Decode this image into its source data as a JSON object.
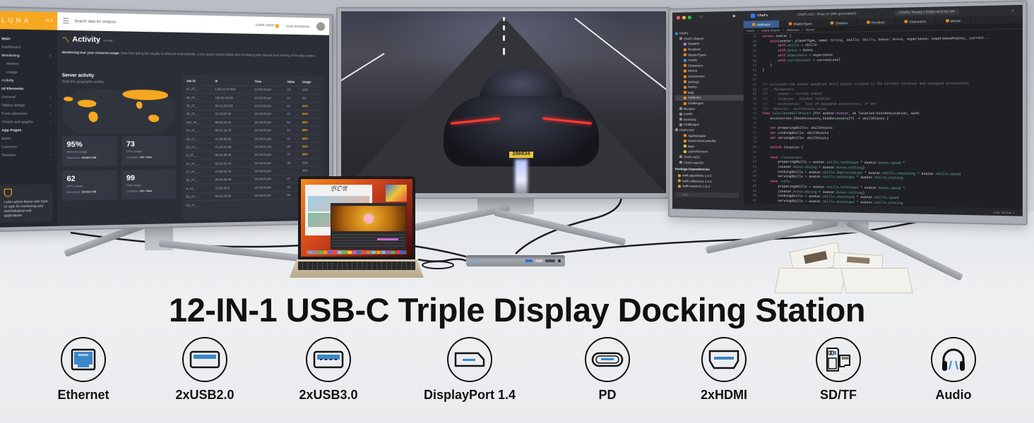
{
  "title": "12-IN-1 USB-C Triple Display Docking Station",
  "ports": [
    {
      "label": "Ethernet",
      "icon": "ethernet-port-icon"
    },
    {
      "label": "2xUSB2.0",
      "icon": "usb2-port-icon"
    },
    {
      "label": "2xUSB3.0",
      "icon": "usb3-port-icon"
    },
    {
      "label": "DisplayPort 1.4",
      "icon": "displayport-icon"
    },
    {
      "label": "PD",
      "icon": "usb-c-pd-icon"
    },
    {
      "label": "2xHDMI",
      "icon": "hdmi-port-icon"
    },
    {
      "label": "SD/TF",
      "icon": "sd-tf-card-icon"
    },
    {
      "label": "Audio",
      "icon": "headphones-icon"
    }
  ],
  "colors": {
    "port_accent": "#3a86c8",
    "dashboard_accent": "#f6a821",
    "title": "#111111"
  },
  "left_monitor": {
    "logo": "LUNA",
    "logo_version": "v1.0",
    "search_placeholder": "Search data for analysis",
    "user_label": "USER VIEW",
    "user_name": "SAM JOHNSON",
    "sidebar": [
      {
        "label": "Main",
        "type": "head"
      },
      {
        "label": "Dashboard",
        "type": "item"
      },
      {
        "label": "Monitoring",
        "type": "active"
      },
      {
        "label": "Metrics",
        "type": "sub"
      },
      {
        "label": "Usage",
        "type": "sub"
      },
      {
        "label": "Activity",
        "type": "sub-active"
      },
      {
        "label": "UI Elements",
        "type": "head"
      },
      {
        "label": "General",
        "type": "item"
      },
      {
        "label": "Tables design",
        "type": "item"
      },
      {
        "label": "Form elements",
        "type": "item"
      },
      {
        "label": "Charts and graphs",
        "type": "item"
      },
      {
        "label": "App Pages",
        "type": "head"
      },
      {
        "label": "Basic",
        "type": "item"
      },
      {
        "label": "Common",
        "type": "item"
      },
      {
        "label": "Timeline",
        "type": "item"
      }
    ],
    "sidebar_box": "LUNA admin theme with Dark UI style for monitoring and web/industrial web applications.",
    "page_title": "Activity",
    "page_title_sup": "overall",
    "description_bold": "Monitoring tour your resource usage.",
    "description": "Data from going live usually is collected automatically. Lorem ipsum activity status and monitoring time interval from running of the data system.",
    "server_title": "Server activity",
    "server_subtitle": "Real time geographic activity",
    "stats": [
      {
        "value": "95%",
        "label": "Memory usage",
        "detail_label": "Allocated:",
        "detail": "2048/4 GB"
      },
      {
        "value": "73",
        "label": "CPU usage",
        "detail_label": "Location:",
        "detail": "US / San"
      },
      {
        "value": "62",
        "label": "GPU usage",
        "detail_label": "Allocated:",
        "detail": "1024/2 GB"
      },
      {
        "value": "99",
        "label": "Disk usage",
        "detail_label": "Location:",
        "detail": "US / San"
      }
    ],
    "jobs_table": {
      "columns": [
        "Job ID",
        "IP",
        "Time",
        "Value",
        "Usage"
      ],
      "rows": [
        [
          "43_AT_...",
          "1.02.21.47.003",
          "12:00:03 pm",
          "23",
          "12%"
        ],
        [
          "43_AT_...",
          "102.52.65.66",
          "12:03:00 pm",
          "24",
          "8%"
        ],
        [
          "43_AT_...",
          "98.12.542.65",
          "14:23:02 pm",
          "61",
          "42%"
        ],
        [
          "43_AT_...",
          "11.13.87.28",
          "15:16:09 pm",
          "47",
          "64%"
        ],
        [
          "108_AT_...",
          "88.56.42.24",
          "16:34:06 pm",
          "53",
          "68%"
        ],
        [
          "24_AT_...",
          "98.54.24.78",
          "16:34:04 pm",
          "14",
          "68%"
        ],
        [
          "43_AT_...",
          "41.65.88.62",
          "16:34:01 pm",
          "24",
          "68%"
        ],
        [
          "22_AT_...",
          "71.15.24.66",
          "16:34:01 pm",
          "29",
          "64%"
        ],
        [
          "8_AT_...",
          "88.53.65.25",
          "16:34:02 pm",
          "37",
          "68%"
        ],
        [
          "37_AT_...",
          "56.56.52.43",
          "16:34:03 pm",
          "38",
          "32%"
        ],
        [
          "27_AT_...",
          "67.65.43.76",
          "16:34:03 pm",
          "-",
          "38%"
        ],
        [
          "20_AT_...",
          "89.56.35.46",
          "16:34:04 pm",
          "47",
          "64%"
        ],
        [
          "8_AT_...",
          "72.54.40.5",
          "16:34:04 pm",
          "33",
          "42%"
        ],
        [
          "82_AT_...",
          "66.65.43.65",
          "16:34:04 pm",
          "29",
          "64%"
        ],
        [
          "43_AT_...",
          "",
          "",
          "",
          ""
        ]
      ]
    }
  },
  "center_monitor": {
    "plate": "200834"
  },
  "right_monitor": {
    "project": "Chef's",
    "scheme": "Chef's iOS",
    "device": "iPad Air (5th generation)",
    "status": "Chef's: Ready | Today at 9:41 AM",
    "tabs": [
      "Attributes",
      "ShaderTypes",
      "Shaders",
      "Renderer",
      "Characters",
      "Menus"
    ],
    "breadcrumb": [
      "Chef's",
      "Chef's Shared",
      "Attributes",
      "Bonus"
    ],
    "navigator": [
      {
        "label": "Chef's",
        "level": 0,
        "color": "#2f7cf6"
      },
      {
        "label": "Chef's Shared",
        "level": 1,
        "color": "#8e8e93"
      },
      {
        "label": "Shaders",
        "level": 2,
        "color": "#b57edc"
      },
      {
        "label": "Renderer",
        "level": 2,
        "color": "#f08a24"
      },
      {
        "label": "ShaderTypes",
        "level": 2,
        "color": "#f08a24"
      },
      {
        "label": "Assets",
        "level": 2,
        "color": "#2f9cf6"
      },
      {
        "label": "Characters",
        "level": 2,
        "color": "#f08a24"
      },
      {
        "label": "Menus",
        "level": 2,
        "color": "#f08a24"
      },
      {
        "label": "Accessories",
        "level": 2,
        "color": "#f08a24"
      },
      {
        "label": "Settings",
        "level": 2,
        "color": "#f08a24"
      },
      {
        "label": "Pantry",
        "level": 2,
        "color": "#f08a24"
      },
      {
        "label": "Map",
        "level": 2,
        "color": "#f08a24"
      },
      {
        "label": "Attributes",
        "level": 2,
        "color": "#f08a24",
        "selected": true
      },
      {
        "label": "Challenges",
        "level": 2,
        "color": "#f08a24"
      },
      {
        "label": "Recipes",
        "level": 1,
        "color": "#8e8e93"
      },
      {
        "label": "Levels",
        "level": 1,
        "color": "#8e8e93"
      },
      {
        "label": "Inventory",
        "level": 1,
        "color": "#8e8e93"
      },
      {
        "label": "Challenges",
        "level": 1,
        "color": "#8e8e93"
      },
      {
        "label": "Chef's iOS",
        "level": 0,
        "color": "#8e8e93"
      },
      {
        "label": "AppDelegate",
        "level": 2,
        "color": "#f08a24"
      },
      {
        "label": "GameViewController",
        "level": 2,
        "color": "#f08a24"
      },
      {
        "label": "Main",
        "level": 2,
        "color": "#e6c04c"
      },
      {
        "label": "LaunchScreen",
        "level": 2,
        "color": "#e6c04c"
      },
      {
        "label": "Chef's tvOS",
        "level": 1,
        "color": "#8e8e93"
      },
      {
        "label": "Chef's macOS",
        "level": 1,
        "color": "#8e8e93"
      }
    ],
    "package_header": "Package Dependencies",
    "packages": [
      "swift-algorithms 1.0.0",
      "swift-collections 1.0.2",
      "swift-numerics 1.0.2"
    ],
    "filter_placeholder": "Filter",
    "cursor_status": "Line: 42  Col: 1",
    "code_lines": [
      {
        "n": "48",
        "html": "<span class='kw'>struct</span> Avatar {"
      },
      {
        "n": "49",
        "html": "    <span class='kw'>init</span>(avatar: playerType, name: <span class='ty'>String</span>, skills: <span class='ty'>Skills</span>, bonus: <span class='ty'>Bonus</span>, experience: experiencePoints, current..."
      },
      {
        "n": "50",
        "html": "        <span class='kw'>self</span>.<span class='pr'>skills</span> = skills"
      },
      {
        "n": "51",
        "html": "        <span class='kw'>self</span>.<span class='pr'>bonus</span> = bonus"
      },
      {
        "n": "52",
        "html": "        <span class='kw'>self</span>.<span class='pr'>experience</span> = experience"
      },
      {
        "n": "53",
        "html": "        <span class='kw'>self</span>.<span class='pr'>currentLevel</span> = currentLevel"
      },
      {
        "n": "54",
        "html": "    }"
      },
      {
        "n": "55",
        "html": "}"
      },
      {
        "n": "56",
        "html": ""
      },
      {
        "n": "57",
        "html": ""
      },
      {
        "n": "67",
        "html": "<span class='cm'>/// Calculate the avatar weighted skill points related to the kitchen location and equipped accessories</span>"
      },
      {
        "n": "68",
        "html": "<span class='cm'>/// - Parameters:</span>"
      },
      {
        "n": "69",
        "html": "<span class='cm'>///   - avatar:  current avatar</span>"
      },
      {
        "n": "70",
        "html": "<span class='cm'>///   - location:  kitchen location</span>"
      },
      {
        "n": "71",
        "html": "<span class='cm'>///   - accessories:  list of equipped accessories, if any</span>"
      },
      {
        "n": "72",
        "html": "<span class='cm'>/// - Returns:  skillPoints value</span>"
      },
      {
        "n": "73",
        "html": "<span class='kw'>func</span> <span class='fn'>calculateSkillPoints</span> (for avatar:<span class='ty'>Avatar</span>, at location:kitchenLocation, with"
      },
      {
        "n": "74",
        "html": "    accessories:[handAccessory,headAccessory]?) -> skillPoints {"
      },
      {
        "n": "75",
        "html": ""
      },
      {
        "n": "76",
        "html": "    <span class='kw'>var</span> preparingSkills: skillPoints"
      },
      {
        "n": "77",
        "html": "    <span class='kw'>var</span> cookingSkills: skillPoints"
      },
      {
        "n": "78",
        "html": "    <span class='kw'>var</span> servingSkills: skillPoints"
      },
      {
        "n": "79",
        "html": ""
      },
      {
        "n": "80",
        "html": "    <span class='kw'>switch</span> location {"
      },
      {
        "n": "81",
        "html": ""
      },
      {
        "n": "82",
        "html": "    <span class='kw'>case</span> .<span class='pr'>restaurant</span>:"
      },
      {
        "n": "83",
        "html": "        preparingSkills = avatar.<span class='pr'>skills</span>.<span class='pr'>technique</span> * avatar.<span class='pr'>bonus</span>.<span class='pr'>speed</span> *"
      },
      {
        "n": "84",
        "html": "        (avatar.<span class='pr'>bonus</span>.<span class='pr'>mixing</span> + avatar.<span class='pr'>bonus</span>.<span class='pr'>cutting</span>)"
      },
      {
        "n": "85",
        "html": "        cookingSkills = avatar.<span class='pr'>skills</span>.<span class='pr'>improvisation</span> * avatar.<span class='pr'>skills</span>.<span class='pr'>seasoning</span> * avatar.<span class='pr'>skills</span>.<span class='pr'>speed</span>"
      },
      {
        "n": "86",
        "html": "        servingSkills = avatar.<span class='pr'>skills</span>.<span class='pr'>technique</span> * avatar.<span class='pr'>skills</span>.<span class='pr'>plating</span>"
      },
      {
        "n": "87",
        "html": "    <span class='kw'>case</span> .<span class='pr'>cafe</span>:"
      },
      {
        "n": "88",
        "html": "        preparingSkills = avatar.<span class='pr'>skills</span>.<span class='pr'>technique</span> * avatar.<span class='pr'>bonus</span>.<span class='pr'>speed</span> *"
      },
      {
        "n": "89",
        "html": "        (avatar.<span class='pr'>bonus</span>.<span class='pr'>mixing</span> + avatar.<span class='pr'>bonus</span>.<span class='pr'>cutting</span>)"
      },
      {
        "n": "90",
        "html": "        cookingSkills = avatar.<span class='pr'>skills</span>.<span class='pr'>seasoning</span> * avatar.<span class='pr'>skills</span>.<span class='pr'>speed</span>"
      },
      {
        "n": "91",
        "html": "        servingSkills = avatar.<span class='pr'>skills</span>.<span class='pr'>technique</span> * avatar.<span class='pr'>skills</span>.<span class='pr'>plating</span>"
      }
    ]
  }
}
